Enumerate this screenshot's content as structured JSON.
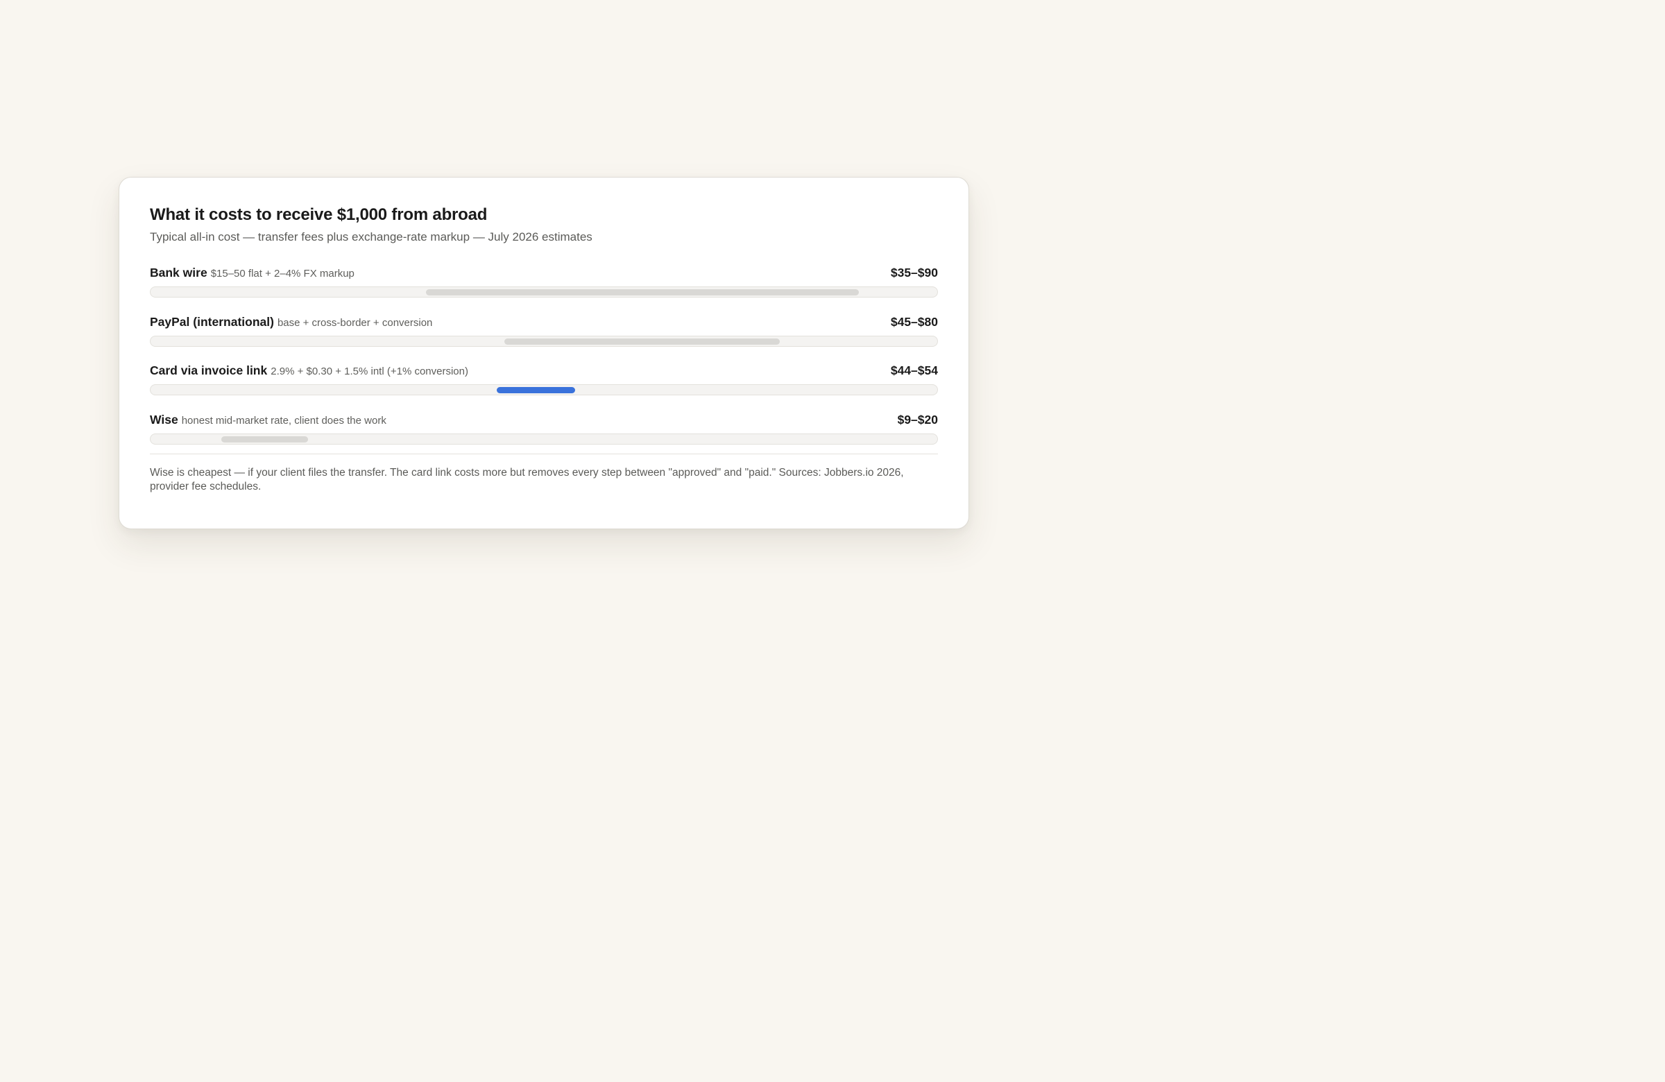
{
  "chart_data": {
    "type": "bar",
    "title": "What it costs to receive $1,000 from abroad",
    "subtitle": "Typical all-in cost — transfer fees plus exchange-rate markup — July 2026 estimates",
    "xlim": [
      0,
      100
    ],
    "grid": false,
    "series": [
      {
        "name": "Bank wire",
        "detail": "$15–50 flat + 2–4% FX markup",
        "range_label": "$35–$90",
        "low": 35,
        "high": 90,
        "highlight": false
      },
      {
        "name": "PayPal (international)",
        "detail": "base + cross-border + conversion",
        "range_label": "$45–$80",
        "low": 45,
        "high": 80,
        "highlight": false
      },
      {
        "name": "Card via invoice link",
        "detail": "2.9% + $0.30 + 1.5% intl (+1% conversion)",
        "range_label": "$44–$54",
        "low": 44,
        "high": 54,
        "highlight": true
      },
      {
        "name": "Wise",
        "detail": "honest mid-market rate, client does the work",
        "range_label": "$9–$20",
        "low": 9,
        "high": 20,
        "highlight": false
      }
    ],
    "footnote": "Wise is cheapest — if your client files the transfer. The card link costs more but removes every step between \"approved\" and \"paid.\" Sources: Jobbers.io 2026, provider fee schedules."
  },
  "colors": {
    "background": "#f9f6f0",
    "card": "#ffffff",
    "track": "#f4f3f1",
    "bar": "#d9d8d5",
    "highlight_bar": "#3a72db"
  }
}
